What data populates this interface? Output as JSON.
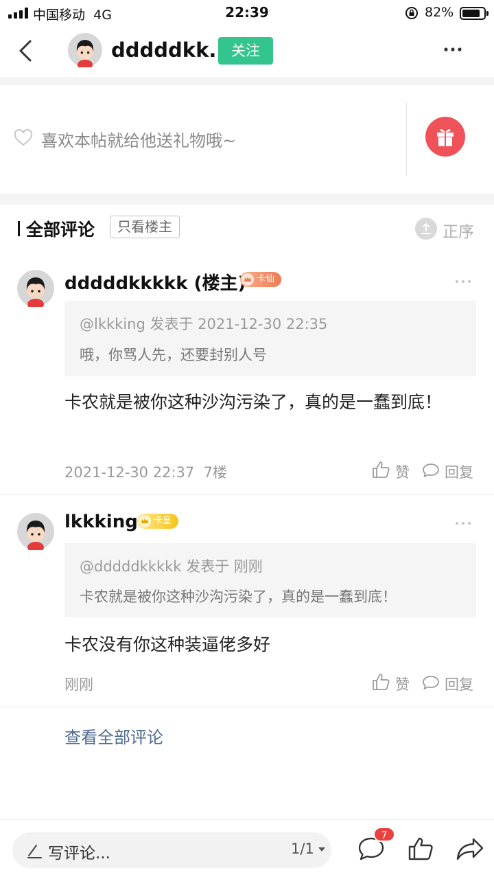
{
  "status_bar": {
    "carrier": "中国移动",
    "network": "4G",
    "time": "22:39",
    "battery": "82%",
    "battery_level": 0.82
  },
  "header": {
    "username": "dddddkk...",
    "follow_label": "关注"
  },
  "gift": {
    "prompt": "喜欢本帖就给他送礼物哦~"
  },
  "comments_section": {
    "title": "全部评论",
    "filter_label": "只看楼主",
    "sort_label": "正序"
  },
  "comments": [
    {
      "username": "dddddkkkkk (楼主)",
      "badge": "卡仙",
      "quote_meta": "@lkkking 发表于 2021-12-30 22:35",
      "quote_text": "哦，你骂人先，还要封别人号",
      "body": "卡农就是被你这种沙沟污染了，真的是一蠢到底！",
      "time": "2021-12-30 22:37",
      "floor": "7楼",
      "like_label": "赞",
      "reply_label": "回复"
    },
    {
      "username": "lkkking",
      "badge": "卡皇",
      "quote_meta": "@dddddkkkkk 发表于 刚刚",
      "quote_text": "卡农就是被你这种沙沟污染了，真的是一蠢到底！",
      "body": "卡农没有你这种装逼佬多好",
      "time": "刚刚",
      "floor": "",
      "like_label": "赞",
      "reply_label": "回复"
    }
  ],
  "view_all_label": "查看全部评论",
  "bottom_bar": {
    "input_placeholder": "写评论...",
    "page_indicator": "1/1",
    "comment_count": "7"
  },
  "colors": {
    "accent_green": "#34c48e",
    "gift_red": "#f0525a",
    "link_blue": "#4d6a93",
    "badge_red": "#e9413f"
  }
}
